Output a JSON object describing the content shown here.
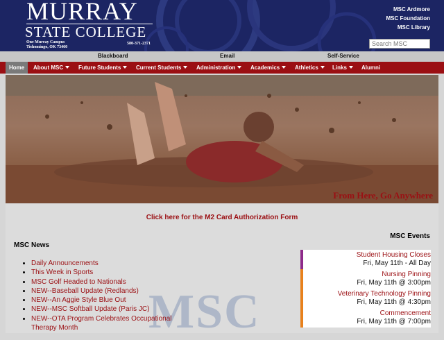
{
  "header": {
    "logo_line1": "MURRAY",
    "logo_line2": "STATE COLLEGE",
    "address_line1": "One Murray Campus",
    "address_line2": "Tishomingo, OK 73460",
    "phone": "580-371-2371",
    "links": [
      "MSC Ardmore",
      "MSC Foundation",
      "MSC Library"
    ],
    "search_placeholder": "Search MSC",
    "colors": {
      "background": "#1c2563",
      "text": "#ffffff"
    }
  },
  "utility_bar": {
    "links": [
      "Blackboard",
      "Email",
      "Self-Service"
    ]
  },
  "nav": {
    "items": [
      {
        "label": "Home",
        "dropdown": false,
        "active": true
      },
      {
        "label": "About MSC",
        "dropdown": true,
        "active": false
      },
      {
        "label": "Future Students",
        "dropdown": true,
        "active": false
      },
      {
        "label": "Current Students",
        "dropdown": true,
        "active": false
      },
      {
        "label": "Administration",
        "dropdown": true,
        "active": false
      },
      {
        "label": "Academics",
        "dropdown": true,
        "active": false
      },
      {
        "label": "Athletics",
        "dropdown": true,
        "active": false
      },
      {
        "label": "Links",
        "dropdown": true,
        "active": false
      },
      {
        "label": "Alumni",
        "dropdown": false,
        "active": false
      }
    ],
    "colors": {
      "background": "#9b0f13",
      "active": "#7a7a7a"
    }
  },
  "hero": {
    "tagline": "From Here, Go Anywhere",
    "image": "mud-slide-photo"
  },
  "content": {
    "m2_link": "Click here for the M2 Card Authorization Form",
    "news_heading": "MSC News",
    "watermark": "MSC",
    "news": [
      "Daily Announcements",
      "This Week in Sports",
      "MSC Golf Headed to Nationals",
      "NEW--Baseball Update (Redlands)",
      "NEW--An Aggie Style Blue Out",
      "NEW--MSC Softball Update (Paris JC)",
      "NEW--OTA Program Celebrates Occupational Therapy Month"
    ],
    "events_heading": "MSC Events",
    "events": [
      {
        "title": "Student Housing Closes",
        "date": "Fri, May 11th - All Day",
        "color": "#8e2a8a"
      },
      {
        "title": "Nursing Pinning",
        "date": "Fri, May 11th @ 3:00pm",
        "color": "#e8811c"
      },
      {
        "title": "Veterinary Technology Pinning",
        "date": "Fri, May 11th @ 4:30pm",
        "color": "#e8811c"
      },
      {
        "title": "Commencement",
        "date": "Fri, May 11th @ 7:00pm",
        "color": "#e8811c"
      }
    ],
    "accent_color": "#9b0f13"
  }
}
